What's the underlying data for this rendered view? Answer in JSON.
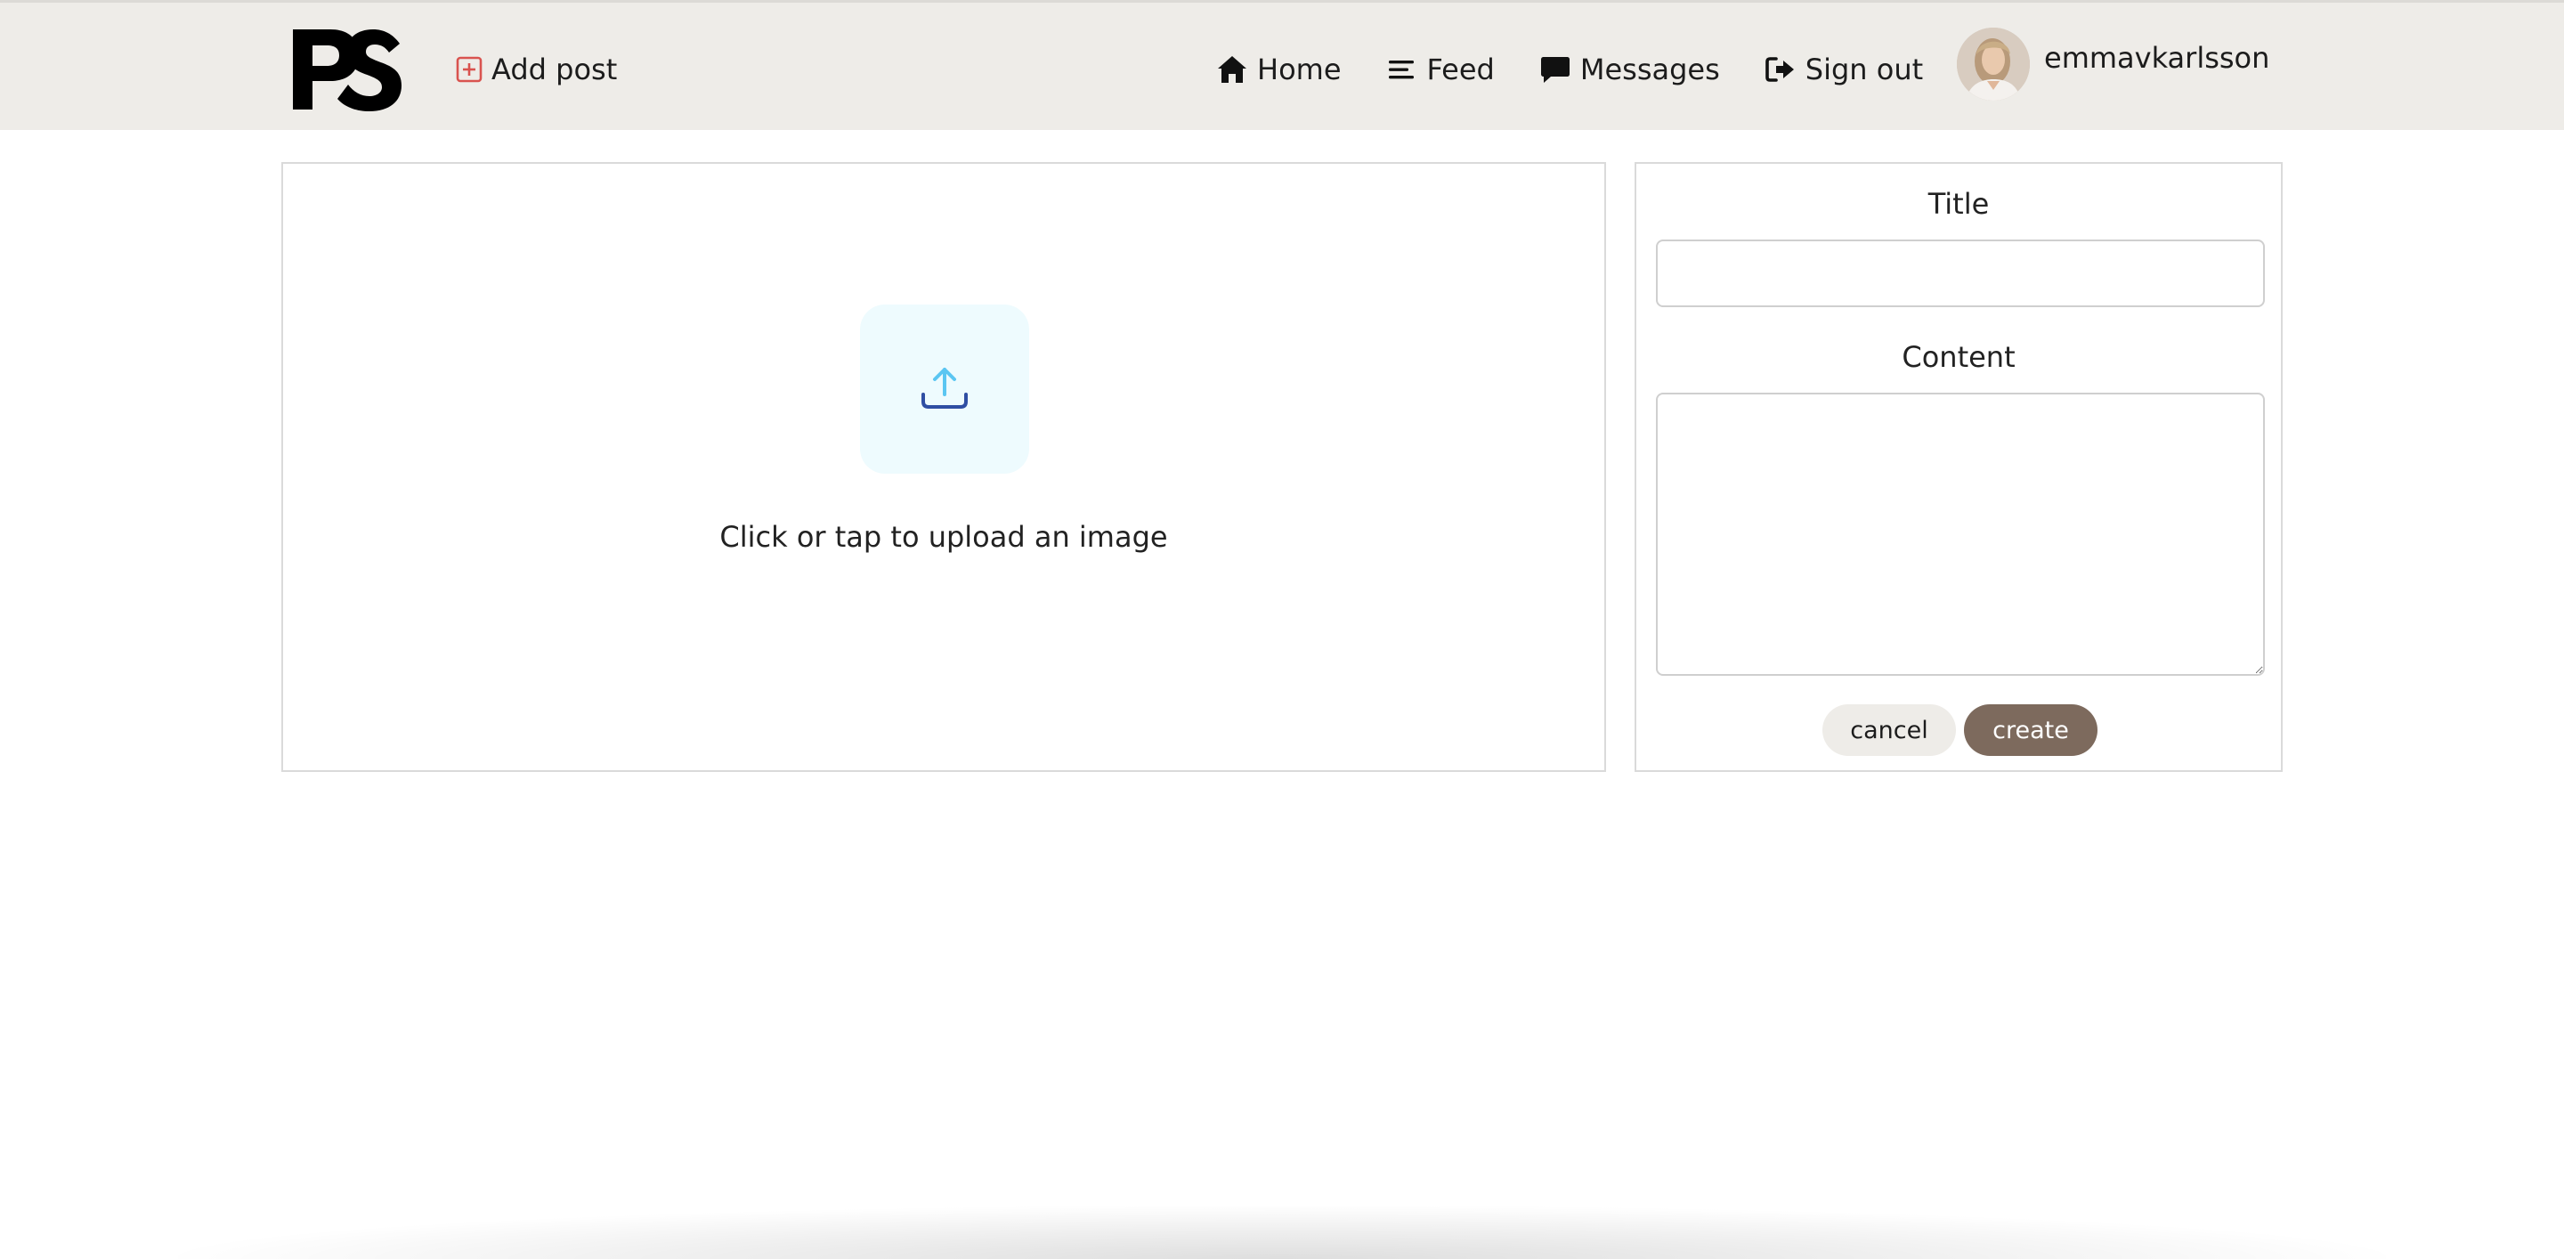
{
  "navbar": {
    "brand_logo": "PS",
    "add_post_label": "Add post",
    "links": {
      "home": "Home",
      "feed": "Feed",
      "messages": "Messages",
      "sign_out": "Sign out"
    },
    "username": "emmavkarlsson"
  },
  "upload": {
    "prompt": "Click or tap to upload an image",
    "icon": "upload-icon"
  },
  "form": {
    "title_label": "Title",
    "title_value": "",
    "content_label": "Content",
    "content_value": "",
    "cancel_label": "cancel",
    "create_label": "create"
  },
  "colors": {
    "navbar_bg": "#eeece8",
    "add_post_icon": "#d9534f",
    "upload_tile_bg": "#eefbfe",
    "upload_arrow": "#5bc6f2",
    "upload_tray": "#2f4ea3",
    "cancel_bg": "#eeece8",
    "create_bg": "#7d6a5d"
  }
}
